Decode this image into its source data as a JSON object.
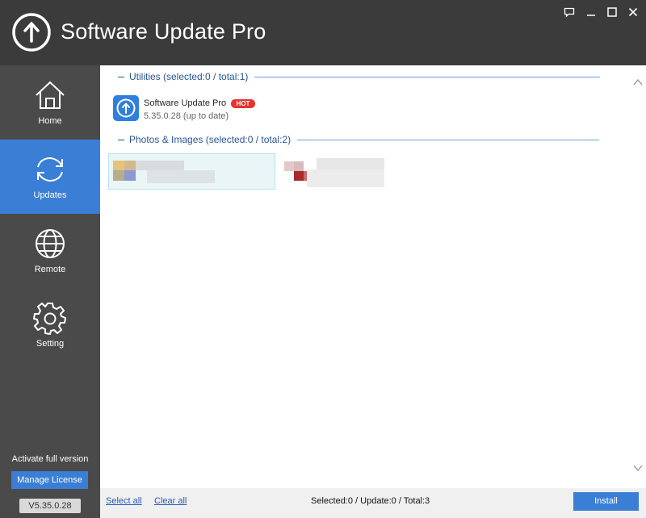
{
  "window": {
    "title": "Software Update Pro",
    "controls": [
      "feedback-icon",
      "minimize-icon",
      "maximize-icon",
      "close-icon"
    ]
  },
  "sidebar": {
    "items": [
      {
        "label": "Home",
        "icon": "home-icon",
        "active": false
      },
      {
        "label": "Updates",
        "icon": "refresh-icon",
        "active": true
      },
      {
        "label": "Remote",
        "icon": "globe-icon",
        "active": false
      },
      {
        "label": "Setting",
        "icon": "gear-icon",
        "active": false
      }
    ],
    "activate_text": "Activate full version",
    "manage_label": "Manage License",
    "version": "V5.35.0.28"
  },
  "sections": [
    {
      "title": "Utilities (selected:0 / total:1)",
      "apps": [
        {
          "name": "Software Update Pro",
          "badge": "HOT",
          "status": "5.35.0.28 (up to date)"
        }
      ]
    },
    {
      "title": "Photos & Images (selected:0 / total:2)",
      "apps": []
    }
  ],
  "footer": {
    "select_all": "Select all",
    "clear_all": "Clear all",
    "status": "Selected:0 / Update:0 / Total:3",
    "install_label": "Install"
  },
  "colors": {
    "titlebar": "#3b3b3b",
    "sidebar": "#4a4a4a",
    "accent": "#3a7fd5",
    "section_text": "#2a5596",
    "hot_badge": "#e8322f"
  }
}
